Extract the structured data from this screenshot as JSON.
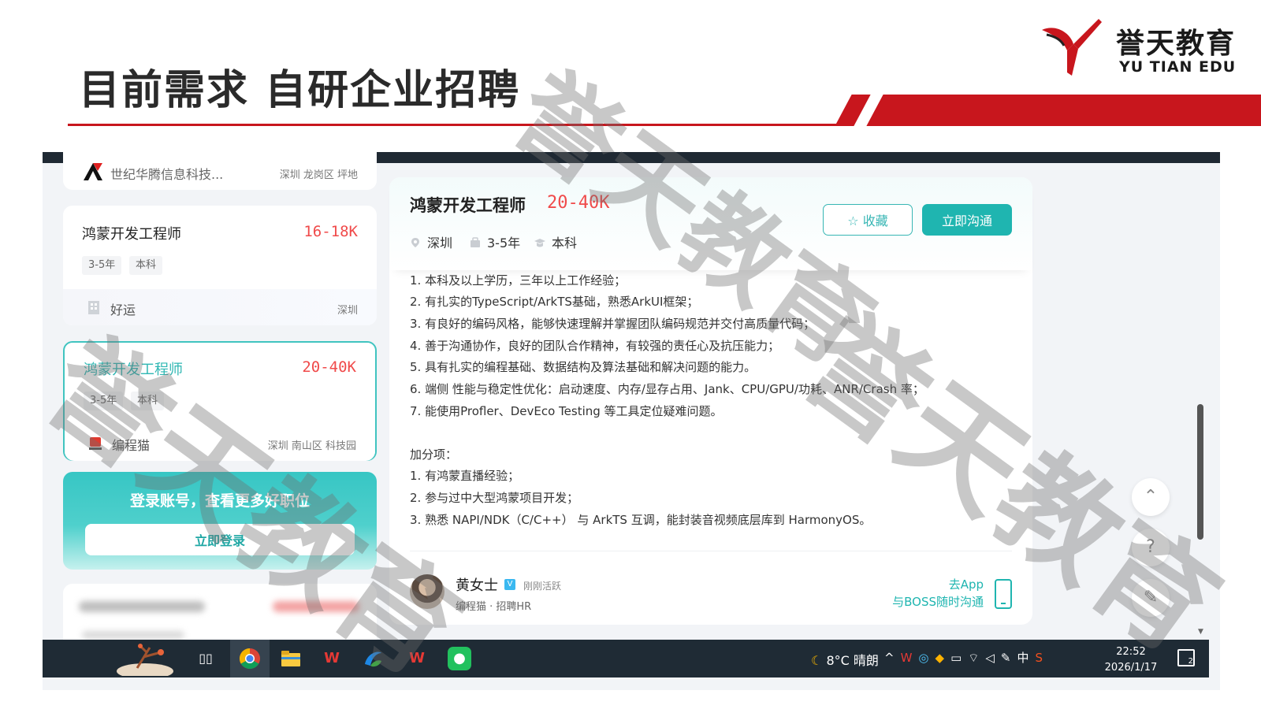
{
  "slide": {
    "title": "目前需求 自研企业招聘",
    "brand_cn": "誉天教育",
    "brand_en": "YU TIAN EDU"
  },
  "colors": {
    "accent_red": "#c8161d",
    "teal": "#1fb5b0",
    "salary_red": "#f04a4a"
  },
  "job_list": {
    "top_company": {
      "name": "世纪华腾信息科技...",
      "location": "深圳 龙岗区 坪地"
    },
    "items": [
      {
        "title": "鸿蒙开发工程师",
        "salary": "16-18K",
        "tags": [
          "3-5年",
          "本科"
        ],
        "company": "好运",
        "location": "深圳",
        "selected": false
      },
      {
        "title": "鸿蒙开发工程师",
        "salary": "20-40K",
        "tags": [
          "3-5年",
          "本科"
        ],
        "company": "编程猫",
        "location": "深圳 南山区 科技园",
        "selected": true
      }
    ],
    "login_promo": {
      "text": "登录账号，查看更多好职位",
      "button": "立即登录"
    }
  },
  "detail": {
    "title": "鸿蒙开发工程师",
    "salary": "20-40K",
    "meta": {
      "city": "深圳",
      "experience": "3-5年",
      "degree": "本科"
    },
    "fav_button": "收藏",
    "chat_button": "立即沟通",
    "requirements": [
      "1. 本科及以上学历，三年以上工作经验；",
      "2. 有扎实的TypeScript/ArkTS基础，熟悉ArkUI框架；",
      "3. 有良好的编码风格，能够快速理解并掌握团队编码规范并交付高质量代码；",
      "4. 善于沟通协作，良好的团队合作精神，有较强的责任心及抗压能力；",
      "5. 具有扎实的编程基础、数据结构及算法基础和解决问题的能力。",
      "6. 端侧 性能与稳定性优化：启动速度、内存/显存占用、Jank、CPU/GPU/功耗、ANR/Crash 率；",
      "7. 能使用Profler、DevEco Testing 等工具定位疑难问题。"
    ],
    "bonus_title": "加分项：",
    "bonus": [
      "1. 有鸿蒙直播经验；",
      "2. 参与过中大型鸿蒙项目开发；",
      "3. 熟悉 NAPI/NDK（C/C++） 与 ArkTS 互调，能封装音视频底层库到 HarmonyOS。"
    ],
    "recruiter": {
      "name": "黄女士",
      "badge": "V",
      "status": "刚刚活跃",
      "role": "编程猫 · 招聘HR",
      "app_line1": "去App",
      "app_line2": "与BOSS随时沟通"
    }
  },
  "float_icons": [
    "back-to-top-icon",
    "help-icon",
    "feedback-icon"
  ],
  "taskbar": {
    "weather": "8°C 晴朗",
    "ime": "中",
    "time": "22:52",
    "date": "2026/1/17",
    "notification_count": "2"
  },
  "watermark": "誉天教育"
}
